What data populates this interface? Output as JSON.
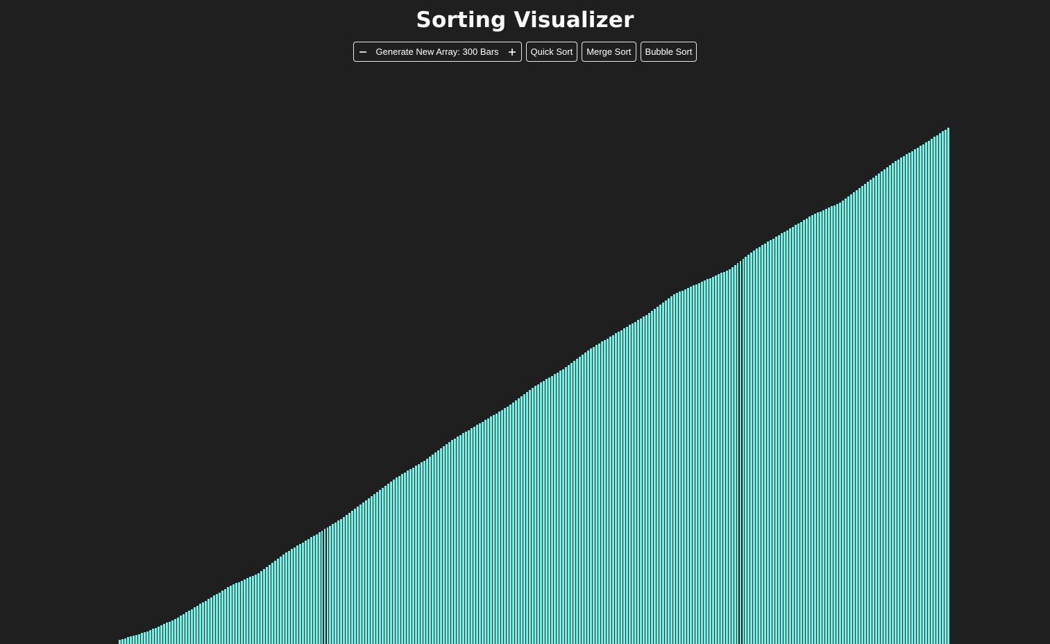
{
  "page": {
    "title": "Sorting Visualizer"
  },
  "controls": {
    "decrease_icon": "minus-icon",
    "generate_label": "Generate New Array: 300 Bars",
    "increase_icon": "plus-icon",
    "quick_sort_label": "Quick Sort",
    "merge_sort_label": "Merge Sort",
    "bubble_sort_label": "Bubble Sort"
  },
  "colors": {
    "background": "#1f1f1f",
    "bar": "#6ff5ea",
    "border": "#e8e8e8"
  },
  "chart_data": {
    "type": "bar",
    "bar_count": 300,
    "order": "ascending",
    "ylim": [
      0,
      100
    ],
    "values_keypoints": [
      [
        0,
        1
      ],
      [
        10,
        3
      ],
      [
        20,
        6
      ],
      [
        30,
        10
      ],
      [
        40,
        14
      ],
      [
        50,
        17
      ],
      [
        60,
        22
      ],
      [
        70,
        26
      ],
      [
        80,
        30
      ],
      [
        90,
        35
      ],
      [
        100,
        40
      ],
      [
        110,
        44
      ],
      [
        120,
        49
      ],
      [
        130,
        53
      ],
      [
        140,
        57
      ],
      [
        150,
        62
      ],
      [
        160,
        66
      ],
      [
        170,
        71
      ],
      [
        180,
        75
      ],
      [
        190,
        79
      ],
      [
        200,
        84
      ],
      [
        210,
        87
      ],
      [
        220,
        90
      ],
      [
        230,
        95
      ],
      [
        240,
        99
      ],
      [
        250,
        103
      ],
      [
        260,
        106
      ],
      [
        270,
        111
      ],
      [
        280,
        116
      ],
      [
        290,
        120
      ],
      [
        299,
        124
      ]
    ]
  }
}
